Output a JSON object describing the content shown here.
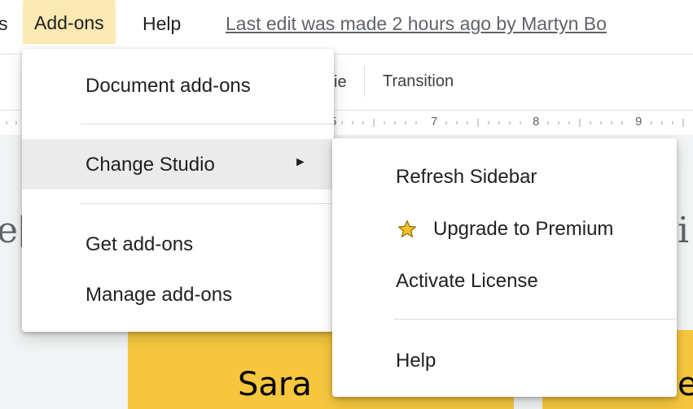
{
  "menubar": {
    "prev_fragment": "s",
    "addons": "Add-ons",
    "help": "Help",
    "last_edit": "Last edit was made 2 hours ago by Martyn Bo"
  },
  "toolbar": {
    "fragment": "ie",
    "transition": "Transition"
  },
  "ruler": {
    "numbers": [
      "5",
      "7",
      "8",
      "9"
    ]
  },
  "slide": {
    "left_fragment": "e[",
    "right_fragment": "i",
    "card_left_text": "Sara",
    "card_right_text": "e"
  },
  "addons_menu": {
    "items": [
      {
        "label": "Document add-ons"
      },
      {
        "label": "Change Studio",
        "submenu_arrow": "►"
      },
      {
        "label": "Get add-ons"
      },
      {
        "label": "Manage add-ons"
      }
    ]
  },
  "change_studio_submenu": {
    "items": [
      {
        "label": "Refresh Sidebar"
      },
      {
        "label": "Upgrade to Premium",
        "icon": "star-icon"
      },
      {
        "label": "Activate License"
      },
      {
        "label": "Help"
      }
    ]
  },
  "colors": {
    "menubar_active": "#fce8b2",
    "menu_hover": "#ebebeb",
    "star_fill": "#f6c026",
    "slide_card": "#f6c73e"
  }
}
